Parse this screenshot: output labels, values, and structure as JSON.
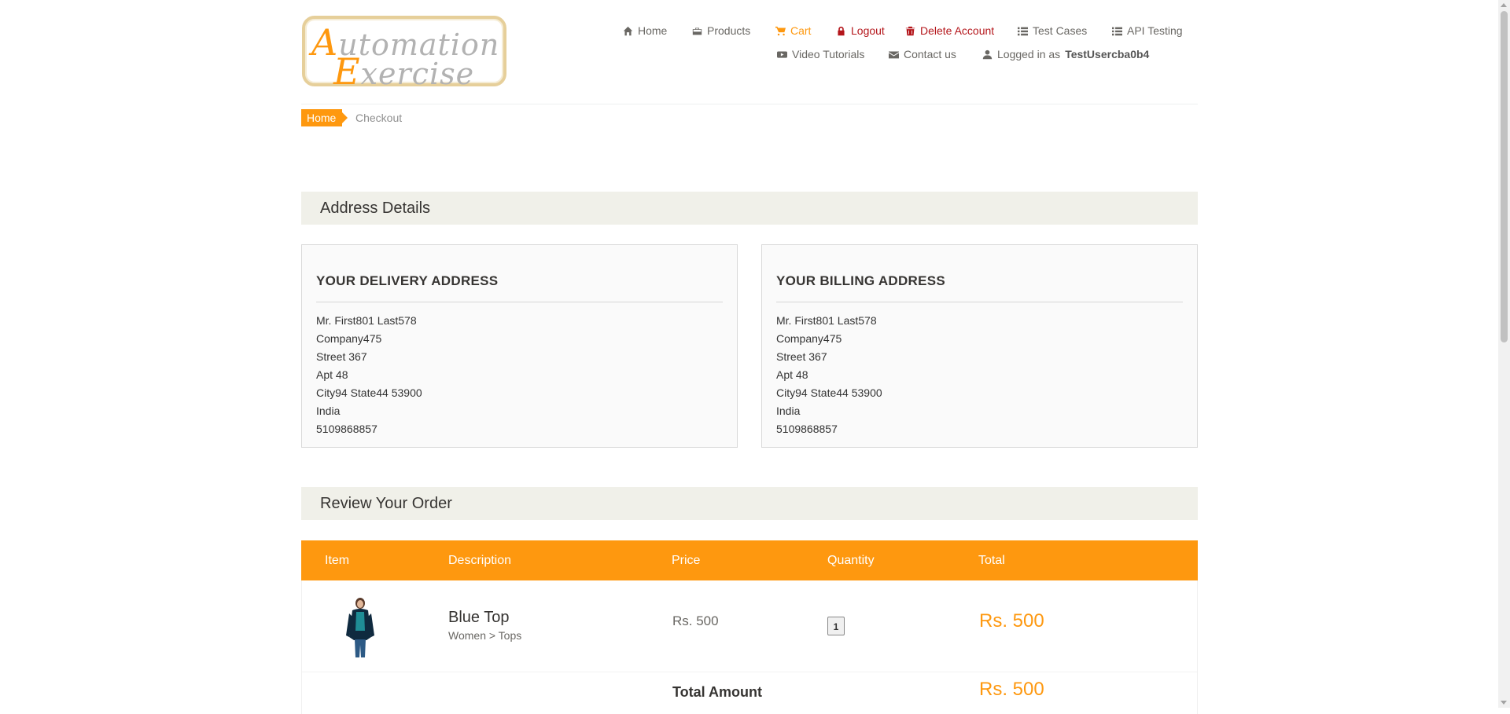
{
  "logo": {
    "line1": "utomation",
    "line1_cap": "A",
    "line2": "xercise",
    "line2_cap": "E"
  },
  "nav": {
    "home": "Home",
    "products": "Products",
    "cart": "Cart",
    "logout": "Logout",
    "delete_account": "Delete Account",
    "test_cases": "Test Cases",
    "api_testing": "API Testing",
    "video_tutorials": "Video Tutorials",
    "contact_us": "Contact us",
    "logged_in_prefix": "Logged in as",
    "username": "TestUsercba0b4"
  },
  "breadcrumb": {
    "home": "Home",
    "current": "Checkout"
  },
  "address_section": {
    "title": "Address Details"
  },
  "delivery": {
    "heading": "YOUR DELIVERY ADDRESS",
    "lines": [
      "Mr. First801 Last578",
      "Company475",
      "Street 367",
      "Apt 48",
      "City94 State44 53900",
      "India",
      "5109868857"
    ]
  },
  "billing": {
    "heading": "YOUR BILLING ADDRESS",
    "lines": [
      "Mr. First801 Last578",
      "Company475",
      "Street 367",
      "Apt 48",
      "City94 State44 53900",
      "India",
      "5109868857"
    ]
  },
  "review_section": {
    "title": "Review Your Order"
  },
  "table": {
    "headers": [
      "Item",
      "Description",
      "Price",
      "Quantity",
      "Total"
    ],
    "rows": [
      {
        "name": "Blue Top",
        "category": "Women > Tops",
        "price": "Rs. 500",
        "quantity": "1",
        "total": "Rs. 500"
      }
    ],
    "total_label": "Total Amount",
    "total_value": "Rs. 500"
  },
  "colors": {
    "accent": "#fe980f",
    "danger": "#b4161b",
    "section_bg": "#f0f0e9"
  }
}
